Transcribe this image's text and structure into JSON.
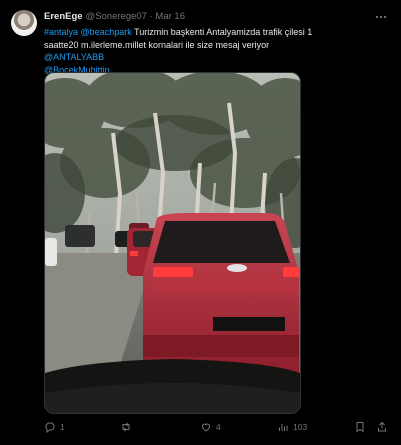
{
  "tweet": {
    "author": {
      "name": "ErenEge",
      "handle": "@Sonerege07",
      "separator": "·",
      "date": "Mar 16"
    },
    "text": {
      "hashtag1": "#antalya",
      "mention1": "@beachpark",
      "body": " Turizmin başkenti Antalyamizda trafik çilesi 1 saatte20 m.ilerleme.millet kornalari ile size  mesaj veriyor ",
      "mention2": "@ANTALYABB",
      "mention3": "@BocekMuhittin"
    },
    "metrics": {
      "replies": "1",
      "likes": "4",
      "views": "103"
    }
  },
  "icons": {
    "more": "more-dots-icon",
    "reply": "reply-icon",
    "retweet": "retweet-icon",
    "like": "heart-icon",
    "views": "analytics-icon",
    "bookmark": "bookmark-icon",
    "share": "share-icon"
  },
  "colors": {
    "background": "#000000",
    "text": "#e7e9ea",
    "muted": "#71767b",
    "link": "#1d9bf0"
  }
}
